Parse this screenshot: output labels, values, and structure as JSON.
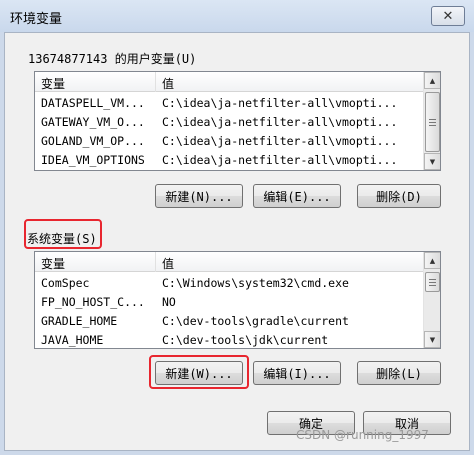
{
  "window": {
    "title": "环境变量",
    "close_glyph": "✕"
  },
  "user_vars": {
    "group_label": "13674877143 的用户变量(U)",
    "col_variable": "变量",
    "col_value": "值",
    "rows": [
      {
        "name": "DATASPELL_VM...",
        "value": "C:\\idea\\ja-netfilter-all\\vmopti..."
      },
      {
        "name": "GATEWAY_VM_O...",
        "value": "C:\\idea\\ja-netfilter-all\\vmopti..."
      },
      {
        "name": "GOLAND_VM_OP...",
        "value": "C:\\idea\\ja-netfilter-all\\vmopti..."
      },
      {
        "name": "IDEA_VM_OPTIONS",
        "value": "C:\\idea\\ja-netfilter-all\\vmopti..."
      }
    ],
    "buttons": {
      "new": "新建(N)...",
      "edit": "编辑(E)...",
      "delete": "删除(D)"
    }
  },
  "system_vars": {
    "group_label": "系统变量(S)",
    "col_variable": "变量",
    "col_value": "值",
    "rows": [
      {
        "name": "ComSpec",
        "value": "C:\\Windows\\system32\\cmd.exe"
      },
      {
        "name": "FP_NO_HOST_C...",
        "value": "NO"
      },
      {
        "name": "GRADLE_HOME",
        "value": "C:\\dev-tools\\gradle\\current"
      },
      {
        "name": "JAVA_HOME",
        "value": "C:\\dev-tools\\jdk\\current"
      }
    ],
    "buttons": {
      "new": "新建(W)...",
      "edit": "编辑(I)...",
      "delete": "删除(L)"
    }
  },
  "footer": {
    "ok": "确定",
    "cancel": "取消"
  },
  "watermark": "CSDN @running_1997",
  "colors": {
    "highlight": "#e8262f",
    "window_frame": "#cdd9ea",
    "client_bg": "#f0f0f0"
  }
}
